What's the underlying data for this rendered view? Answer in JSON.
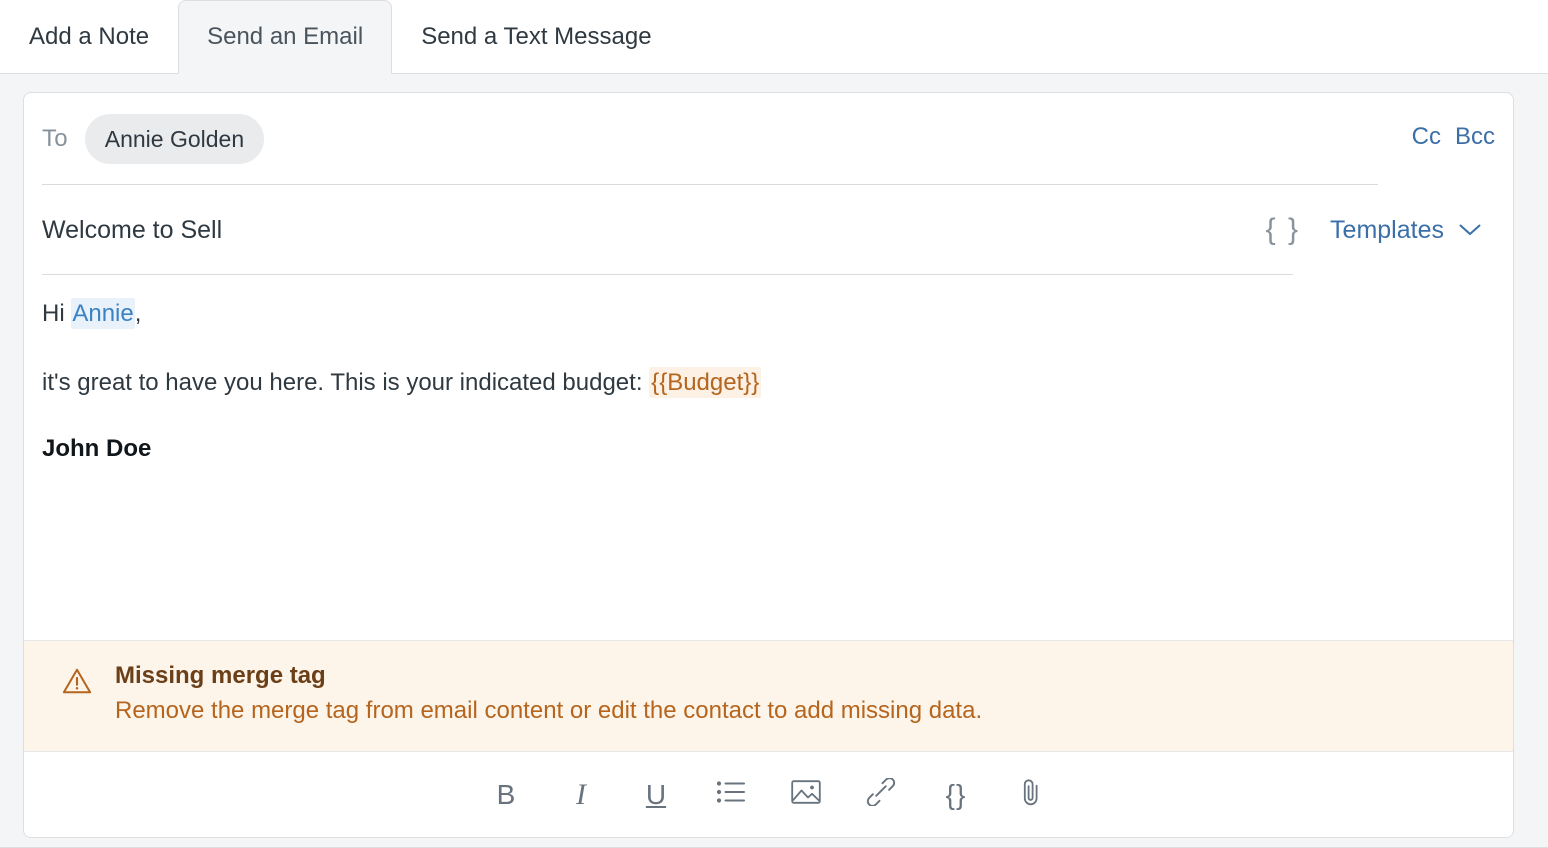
{
  "tabs": [
    {
      "label": "Add a Note",
      "active": false
    },
    {
      "label": "Send an Email",
      "active": true
    },
    {
      "label": "Send a Text Message",
      "active": false
    }
  ],
  "composer": {
    "to": {
      "label": "To",
      "recipients": [
        "Annie Golden"
      ],
      "cc_label": "Cc",
      "bcc_label": "Bcc"
    },
    "subject": {
      "value": "Welcome to Sell",
      "merge_tag_icon": "{ }",
      "templates_label": "Templates",
      "templates_chevron": "chevron-down-icon"
    },
    "body": {
      "greeting_prefix": "Hi ",
      "greeting_tag": "Annie",
      "greeting_suffix": ",",
      "paragraph_prefix": "it's great to have you here. This is your indicated budget: ",
      "paragraph_tag": "{{Budget}}",
      "signature": "John Doe"
    },
    "warning": {
      "icon": "alert-triangle-icon",
      "title": "Missing merge tag",
      "description": "Remove the merge tag from email content or edit the contact to add missing data."
    },
    "toolbar": [
      {
        "name": "bold-icon",
        "glyph": "B",
        "style": ""
      },
      {
        "name": "italic-icon",
        "glyph": "I",
        "style": "ital"
      },
      {
        "name": "underline-icon",
        "glyph": "U",
        "style": "und"
      },
      {
        "name": "bulleted-list-icon",
        "glyph": "",
        "style": "svg"
      },
      {
        "name": "image-icon",
        "glyph": "",
        "style": "svg"
      },
      {
        "name": "link-icon",
        "glyph": "",
        "style": "svg"
      },
      {
        "name": "merge-tag-icon",
        "glyph": "{}",
        "style": "brace"
      },
      {
        "name": "attachment-icon",
        "glyph": "",
        "style": "svg"
      }
    ]
  },
  "colors": {
    "accent_link": "#3b6fa8",
    "warning_text": "#b5651d",
    "warning_bg": "#fdf4ea",
    "resolved_tag": "#3b82c4",
    "panel_bg": "#f4f5f7"
  }
}
